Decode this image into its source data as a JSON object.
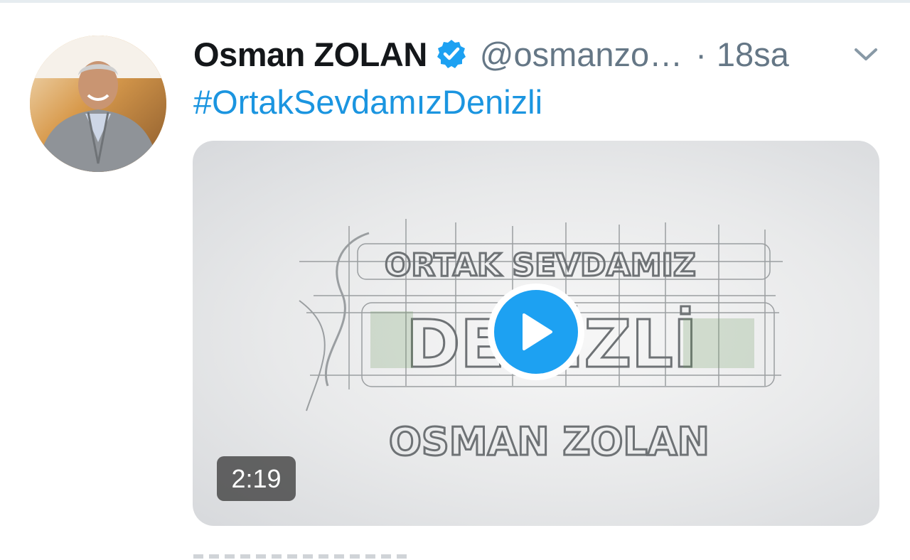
{
  "tweet": {
    "display_name": "Osman ZOLAN",
    "handle": "@osmanzo…",
    "separator": "·",
    "timestamp": "18sa",
    "text": "#OrtakSevdamızDenizli",
    "verified_icon": "verified-badge-icon",
    "menu_icon": "chevron-down-icon"
  },
  "media": {
    "type": "video",
    "duration": "2:19",
    "play_icon": "play-icon",
    "thumbnail_logo_text": [
      "ORTAK SEVDAMIZ",
      "DENİZLİ",
      "OSMAN ZOLAN"
    ]
  },
  "colors": {
    "link_blue": "#1b95e0",
    "verified_blue": "#1da1f2",
    "name_black": "#14171a",
    "muted_gray": "#657786"
  }
}
